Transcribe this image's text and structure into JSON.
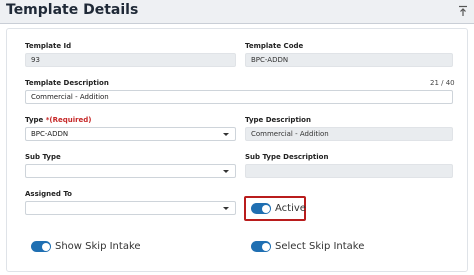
{
  "header": {
    "title": "Template Details",
    "collapse_icon": "collapse-up-icon"
  },
  "form": {
    "template_id": {
      "label": "Template Id",
      "value": "93"
    },
    "template_code": {
      "label": "Template Code",
      "value": "BPC-ADDN"
    },
    "template_description": {
      "label": "Template Description",
      "value": "Commercial - Addition",
      "counter": "21 / 40"
    },
    "type": {
      "label": "Type",
      "required": "*(Required)",
      "value": "BPC-ADDN"
    },
    "type_description": {
      "label": "Type Description",
      "value": "Commercial - Addition"
    },
    "sub_type": {
      "label": "Sub Type",
      "value": ""
    },
    "sub_type_description": {
      "label": "Sub Type Description",
      "value": ""
    },
    "assigned_to": {
      "label": "Assigned To",
      "value": ""
    }
  },
  "toggles": {
    "active": {
      "label": "Active",
      "on": true
    },
    "show_skip_intake": {
      "label": "Show Skip Intake",
      "on": true
    },
    "select_skip_intake": {
      "label": "Select Skip Intake",
      "on": true
    }
  },
  "colors": {
    "toggle_on": "#1f6fb2",
    "highlight_border": "#b91c1c",
    "required": "#c62828"
  }
}
